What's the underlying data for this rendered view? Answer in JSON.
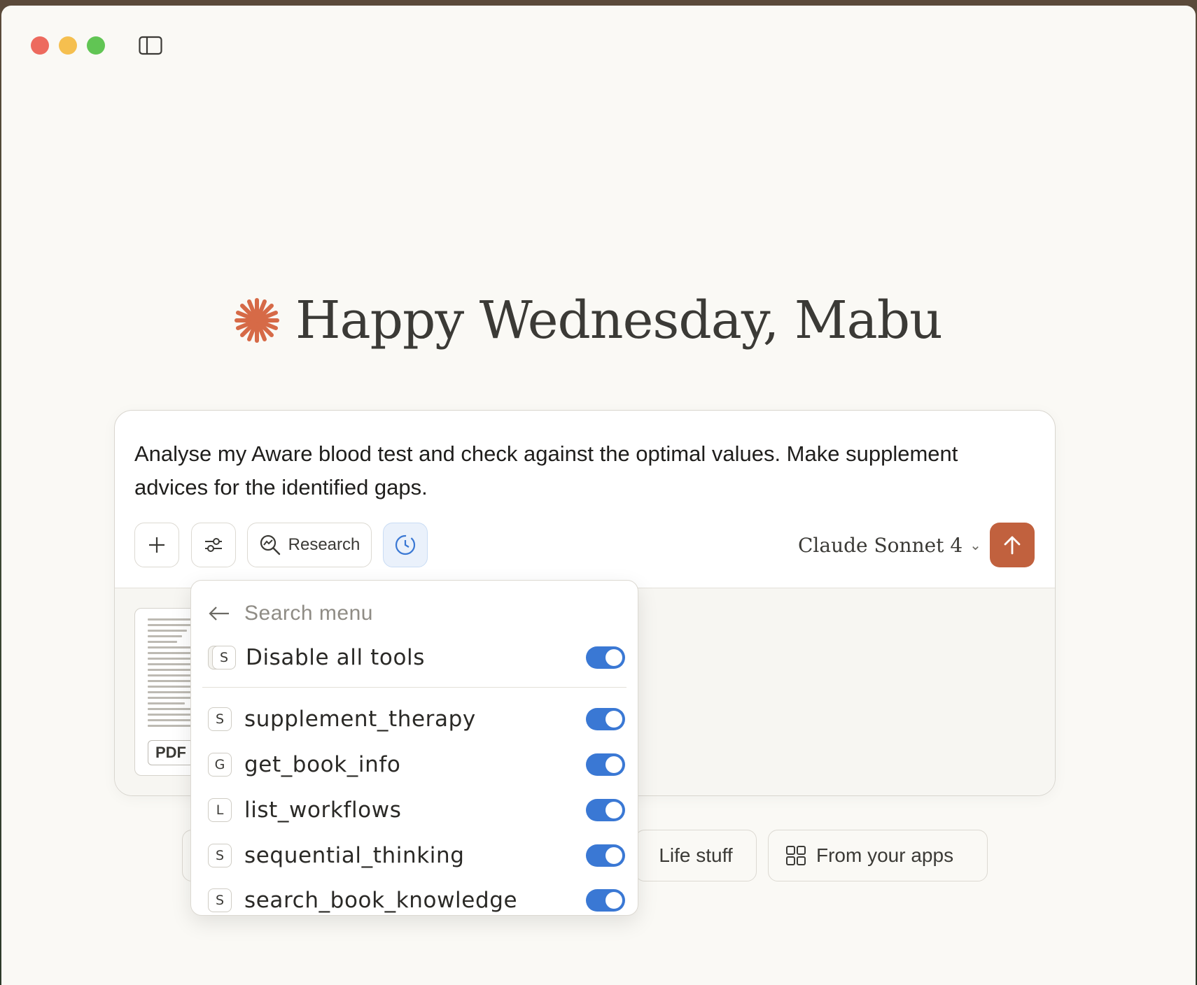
{
  "greeting": {
    "text": "Happy Wednesday, Mabu"
  },
  "composer": {
    "prompt": "Analyse my Aware blood test and check against the optimal values. Make supplement advices for the identified gaps.",
    "research_label": "Research",
    "model_label": "Claude Sonnet 4",
    "attachment": {
      "type_label": "PDF"
    }
  },
  "tools_menu": {
    "search_placeholder": "Search menu",
    "disable_all": {
      "badge": "S",
      "label": "Disable all tools",
      "enabled": true
    },
    "tools": [
      {
        "badge": "S",
        "label": "supplement_therapy",
        "enabled": true
      },
      {
        "badge": "G",
        "label": "get_book_info",
        "enabled": true
      },
      {
        "badge": "L",
        "label": "list_workflows",
        "enabled": true
      },
      {
        "badge": "S",
        "label": "sequential_thinking",
        "enabled": true
      },
      {
        "badge": "S",
        "label": "search_book_knowledge",
        "enabled": true
      }
    ]
  },
  "chips": {
    "life": "Life stuff",
    "apps": "From your apps"
  },
  "colors": {
    "accent": "#c1613e",
    "toggle": "#3a78d4",
    "background": "#faf9f5"
  }
}
